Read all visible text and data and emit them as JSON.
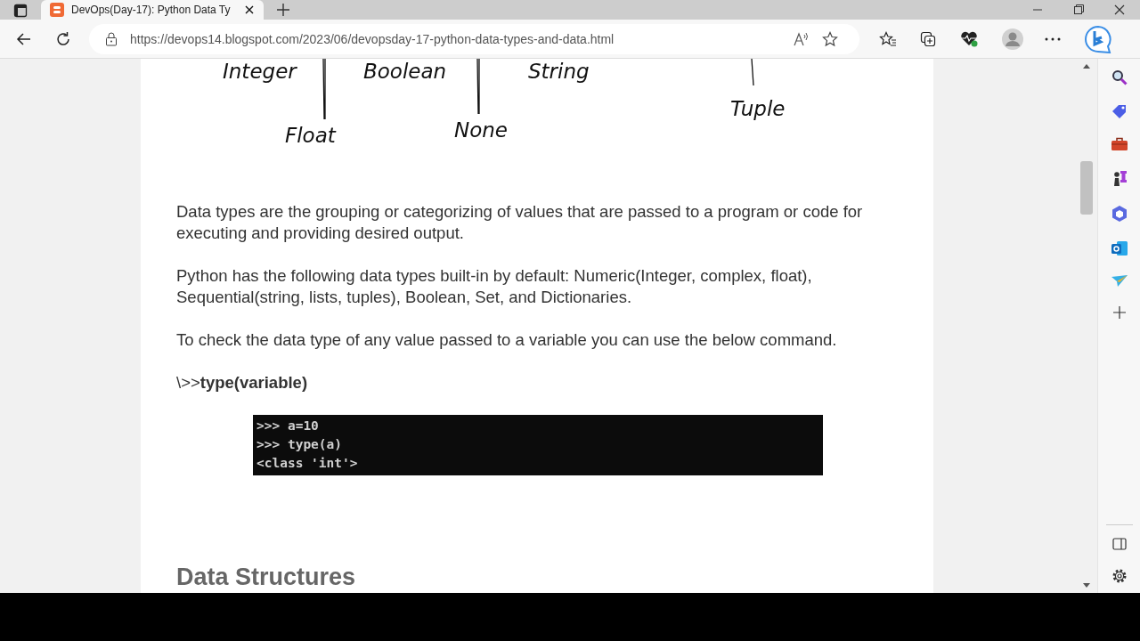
{
  "tabs": [
    {
      "title": "DevOps(Day-17): Python Data Ty",
      "selected": true
    }
  ],
  "address": "https://devops14.blogspot.com/2023/06/devopsday-17-python-data-types-and-data.html",
  "diagram": {
    "labels": [
      "Integer",
      "Boolean",
      "String",
      "Float",
      "None",
      "Tuple"
    ]
  },
  "paragraphs": [
    "Data types are the grouping or categorizing of values that are passed to a program or code for executing and providing desired output.",
    "Python has the following data types built-in by default: Numeric(Integer, complex, float), Sequential(string, lists, tuples), Boolean, Set, and Dictionaries.",
    "To check the data type of any value passed to a variable you can use the below command.",
    "\\>>**type(variable)**"
  ],
  "code_lines": [
    ">>> a=10",
    ">>> type(a)",
    "<class 'int'>"
  ],
  "heading": "Data Structures"
}
